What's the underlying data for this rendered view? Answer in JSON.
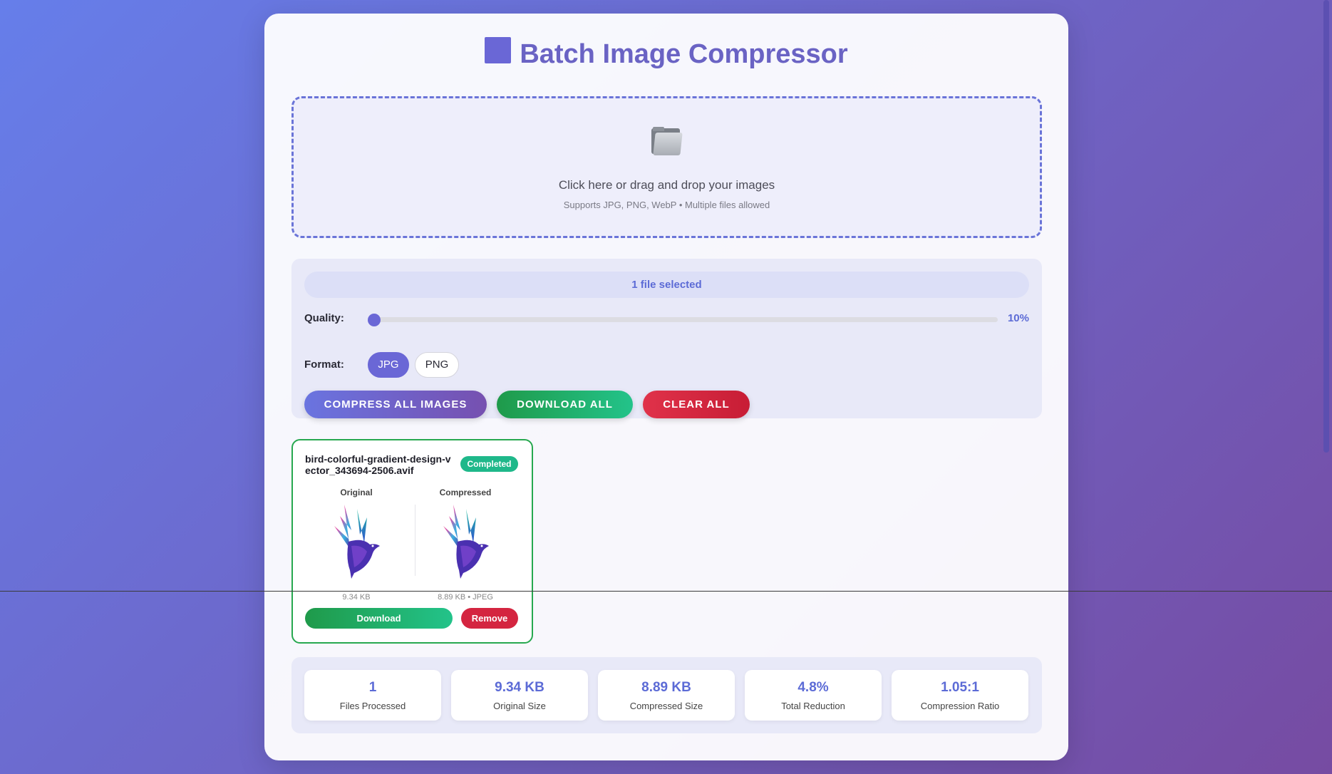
{
  "app": {
    "title": "Batch Image Compressor"
  },
  "dropzone": {
    "main_text": "Click here or drag and drop your images",
    "sub_text": "Supports JPG, PNG, WebP • Multiple files allowed",
    "icon": "folder-icon"
  },
  "controls": {
    "selected_text": "1 file selected",
    "quality_label": "Quality:",
    "quality_value": "10%",
    "quality_fraction": 0.1,
    "format_label": "Format:",
    "formats": [
      "JPG",
      "PNG"
    ],
    "selected_format": "JPG",
    "compress_label": "COMPRESS ALL IMAGES",
    "download_all_label": "DOWNLOAD ALL",
    "clear_all_label": "CLEAR ALL"
  },
  "files": [
    {
      "name": "bird-colorful-gradient-design-vector_343694-2506.avif",
      "status": "Completed",
      "original_label": "Original",
      "compressed_label": "Compressed",
      "original_size": "9.34 KB",
      "compressed_info": "8.89 KB • JPEG",
      "download_label": "Download",
      "remove_label": "Remove"
    }
  ],
  "stats": [
    {
      "value": "1",
      "label": "Files Processed"
    },
    {
      "value": "9.34 KB",
      "label": "Original Size"
    },
    {
      "value": "8.89 KB",
      "label": "Compressed Size"
    },
    {
      "value": "4.8%",
      "label": "Total Reduction"
    },
    {
      "value": "1.05:1",
      "label": "Compression Ratio"
    }
  ],
  "colors": {
    "accent": "#6a67d6",
    "success": "#27a84f",
    "danger": "#d42540",
    "badge": "#1fb88a"
  }
}
